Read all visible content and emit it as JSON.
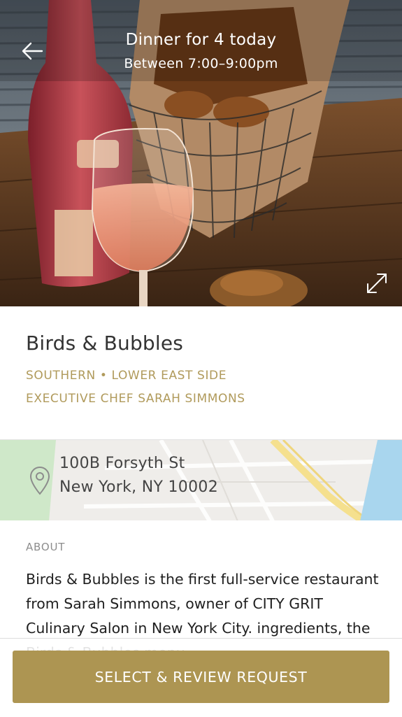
{
  "header": {
    "title": "Dinner for 4 today",
    "subtitle": "Between 7:00–9:00pm"
  },
  "icons": {
    "back": "arrow-left-icon",
    "expand": "expand-icon",
    "location": "map-pin-icon"
  },
  "restaurant": {
    "name": "Birds & Bubbles",
    "cuisine_line": "SOUTHERN • LOWER EAST SIDE",
    "chef_line": "EXECUTIVE CHEF SARAH SIMMONS"
  },
  "location": {
    "street": "100B Forsyth St",
    "city_line": "New York, NY 10002"
  },
  "about": {
    "label": "ABOUT",
    "text": "Birds & Bubbles is the first full-service restaurant from Sarah Simmons, owner of CITY GRIT Culinary Salon in New York City. ingredients, the Birds & Bubbles menu"
  },
  "cta": {
    "label": "SELECT & REVIEW REQUEST"
  },
  "colors": {
    "accent": "#ad9552",
    "tag_text": "#b09a5b"
  }
}
